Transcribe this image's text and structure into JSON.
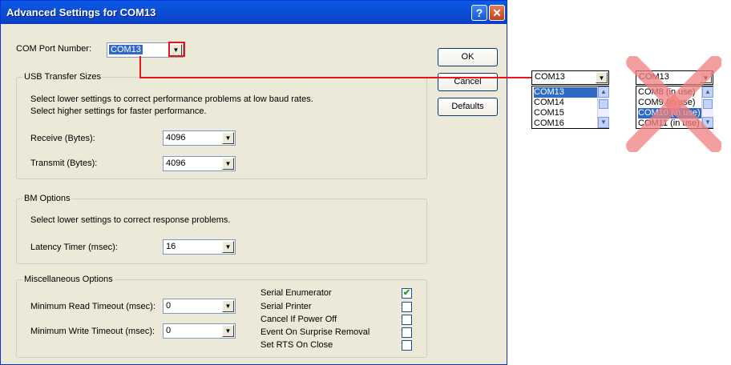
{
  "window": {
    "title": "Advanced Settings for COM13",
    "help_label": "?",
    "close_label": "✕"
  },
  "com_port": {
    "label": "COM Port Number:",
    "value": "COM13"
  },
  "usb_transfer": {
    "title": "USB Transfer Sizes",
    "desc1": "Select lower settings to correct performance problems at low baud rates.",
    "desc2": "Select higher settings for faster performance.",
    "receive_label": "Receive (Bytes):",
    "receive_value": "4096",
    "transmit_label": "Transmit (Bytes):",
    "transmit_value": "4096"
  },
  "bm_options": {
    "title": "BM Options",
    "desc": "Select lower settings to correct response problems.",
    "latency_label": "Latency Timer (msec):",
    "latency_value": "16"
  },
  "misc": {
    "title": "Miscellaneous Options",
    "min_read_label": "Minimum Read Timeout (msec):",
    "min_read_value": "0",
    "min_write_label": "Minimum Write Timeout (msec):",
    "min_write_value": "0",
    "options": [
      {
        "label": "Serial Enumerator",
        "checked": true
      },
      {
        "label": "Serial Printer",
        "checked": false
      },
      {
        "label": "Cancel If Power Off",
        "checked": false
      },
      {
        "label": "Event On Surprise Removal",
        "checked": false
      },
      {
        "label": "Set RTS On Close",
        "checked": false
      }
    ]
  },
  "buttons": {
    "ok": "OK",
    "cancel": "Cancel",
    "defaults": "Defaults"
  },
  "dropdown_good": {
    "value": "COM13",
    "items": [
      "COM13",
      "COM14",
      "COM15",
      "COM16"
    ],
    "selected_index": 0
  },
  "dropdown_bad": {
    "value": "COM13",
    "items": [
      "COM8 (in use)",
      "COM9 (in use)",
      "COM10 (in use)",
      "COM11 (in use)"
    ],
    "selected_index": 2
  },
  "colors": {
    "callout_red": "#e8141c",
    "cross_red": "#f08080",
    "selection": "#316ac5"
  },
  "icons": {
    "dropdown_arrow": "▼",
    "scroll_up": "▲",
    "scroll_down": "▼",
    "check": "✔"
  }
}
